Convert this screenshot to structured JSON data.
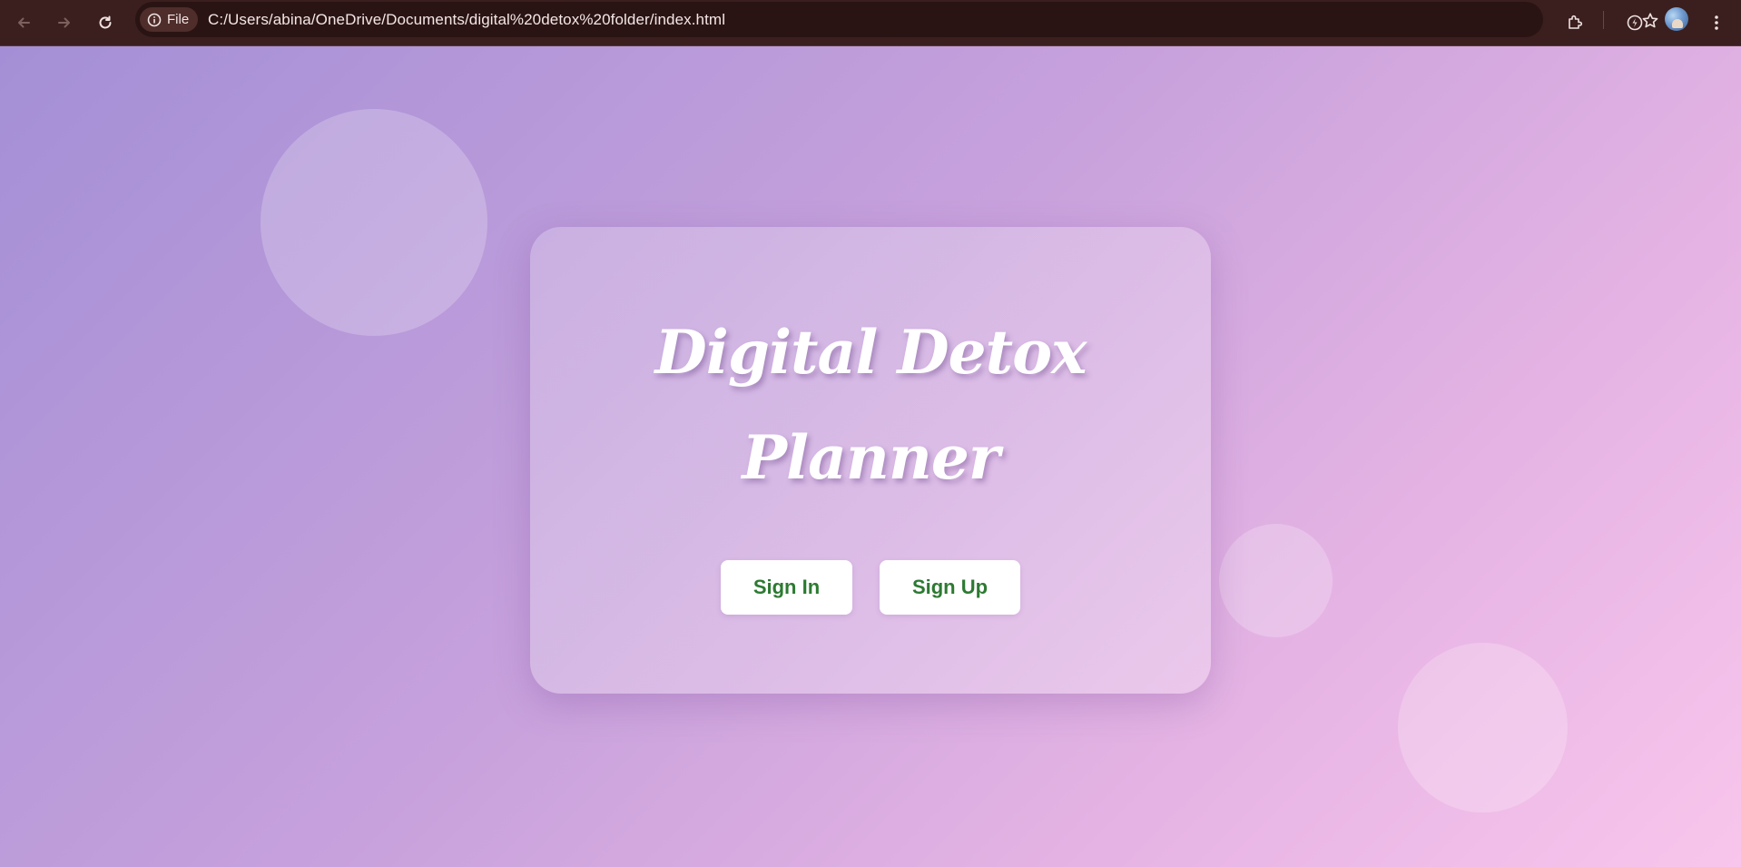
{
  "browser": {
    "scheme_chip_label": "File",
    "url": "C:/Users/abina/OneDrive/Documents/digital%20detox%20folder/index.html",
    "icons": [
      "back-arrow-icon",
      "forward-arrow-icon",
      "reload-icon",
      "info-icon",
      "star-icon",
      "extensions-icon",
      "performance-icon",
      "profile-avatar",
      "more-menu-icon"
    ]
  },
  "page": {
    "title_line1": "Digital Detox",
    "title_line2": "Planner",
    "sign_in_label": "Sign In",
    "sign_up_label": "Sign Up",
    "colors": {
      "background_start": "#a48fd6",
      "background_end": "#f8c5ec",
      "button_text": "#2d7a32",
      "title_text": "#ffffff"
    }
  }
}
